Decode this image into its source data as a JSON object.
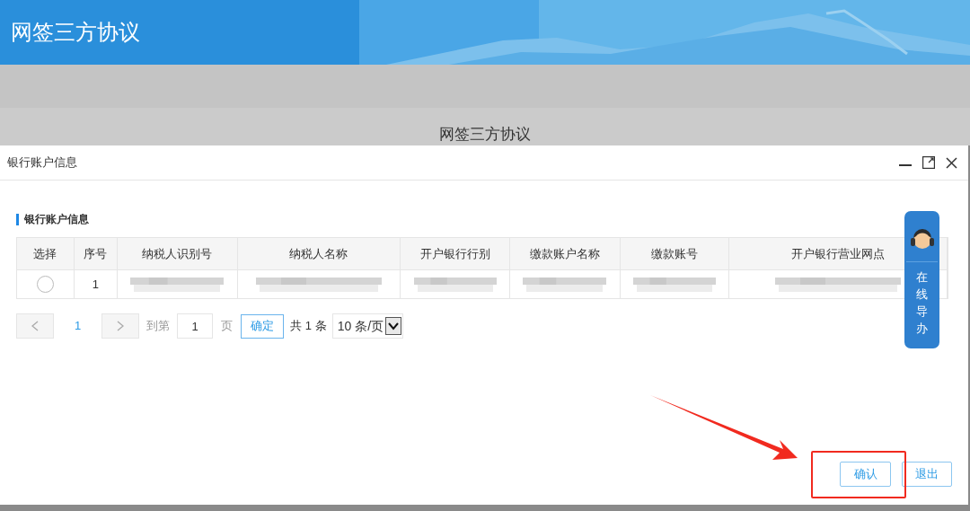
{
  "header": {
    "title": "网签三方协议"
  },
  "background": {
    "page_title": "网签三方协议"
  },
  "dialog": {
    "title": "银行账户信息",
    "section_title": "银行账户信息",
    "table": {
      "columns": [
        "选择",
        "序号",
        "纳税人识别号",
        "纳税人名称",
        "开户银行行别",
        "缴款账户名称",
        "缴款账号",
        "开户银行营业网点"
      ],
      "rows": [
        {
          "selected": false,
          "index": "1",
          "redacted": [
            true,
            true,
            true,
            true,
            true,
            true
          ]
        }
      ]
    },
    "pagination": {
      "prev_disabled": true,
      "current": "1",
      "next_disabled": true,
      "goto_label": "到第",
      "page_value": "1",
      "page_unit": "页",
      "confirm": "确定",
      "total": "共 1 条",
      "page_size": "10 条/页"
    },
    "helper": {
      "label": "在线导办"
    },
    "buttons": [
      "确认",
      "退出"
    ]
  }
}
